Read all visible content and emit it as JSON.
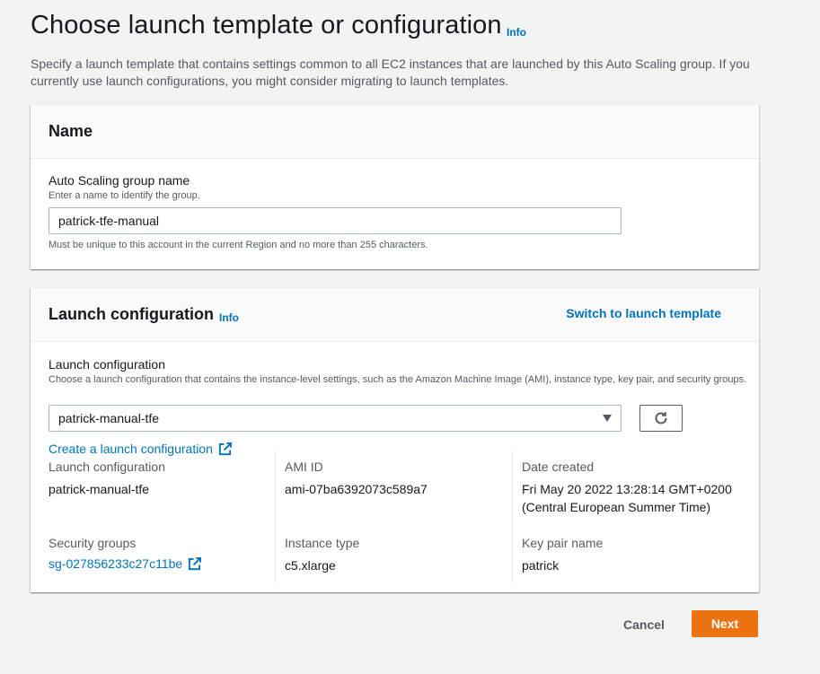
{
  "page": {
    "title": "Choose launch template or configuration",
    "title_info": "Info",
    "description": "Specify a launch template that contains settings common to all EC2 instances that are launched by this Auto Scaling group. If you currently use launch configurations, you might consider migrating to launch templates."
  },
  "name_panel": {
    "title": "Name",
    "field_label": "Auto Scaling group name",
    "field_desc": "Enter a name to identify the group.",
    "field_value": "patrick-tfe-manual",
    "constraint": "Must be unique to this account in the current Region and no more than 255 characters."
  },
  "launch_panel": {
    "title": "Launch configuration",
    "title_info": "Info",
    "switch_link": "Switch to launch template",
    "field_label": "Launch configuration",
    "field_desc": "Choose a launch configuration that contains the instance-level settings, such as the Amazon Machine Image (AMI), instance type, key pair, and security groups.",
    "selected": "patrick-manual-tfe",
    "create_link": "Create a launch configuration",
    "details": {
      "launch_configuration": {
        "key": "Launch configuration",
        "value": "patrick-manual-tfe"
      },
      "ami_id": {
        "key": "AMI ID",
        "value": "ami-07ba6392073c589a7"
      },
      "date_created": {
        "key": "Date created",
        "value_line1": "Fri May 20 2022 13:28:14 GMT+0200",
        "value_line2": "(Central European Summer Time)"
      },
      "security_groups": {
        "key": "Security groups",
        "value": "sg-027856233c27c11be"
      },
      "instance_type": {
        "key": "Instance type",
        "value": "c5.xlarge"
      },
      "key_pair": {
        "key": "Key pair name",
        "value": "patrick"
      }
    }
  },
  "footer": {
    "cancel": "Cancel",
    "next": "Next"
  },
  "colors": {
    "link": "#0073bb",
    "primary_button": "#ec7211",
    "background": "#f2f3f3"
  }
}
